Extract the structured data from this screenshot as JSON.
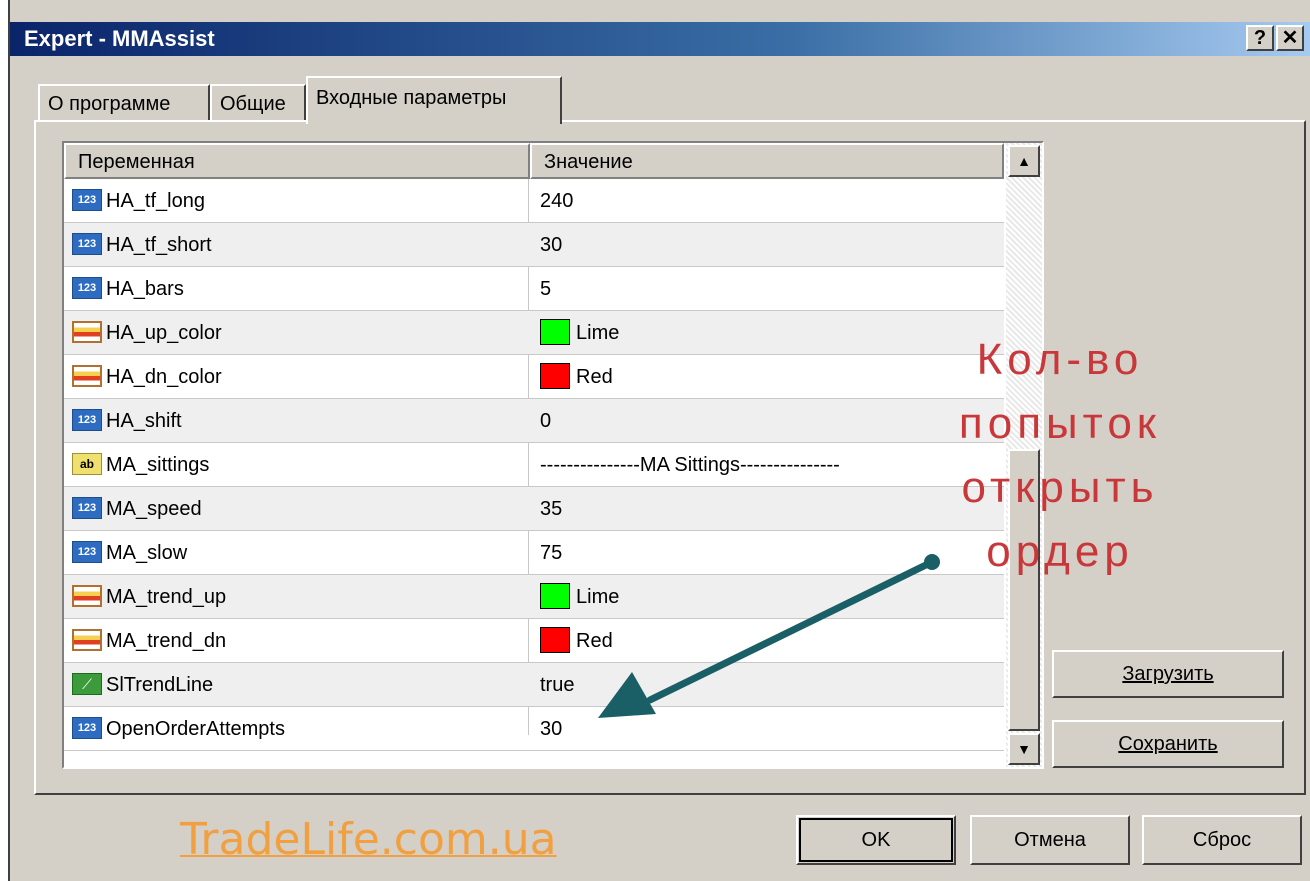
{
  "window": {
    "title": "Expert - MMAssist",
    "help_label": "?",
    "close_label": "✕"
  },
  "tabs": [
    {
      "label": "О программе"
    },
    {
      "label": "Общие"
    },
    {
      "label": "Входные параметры"
    }
  ],
  "grid": {
    "headers": [
      "Переменная",
      "Значение"
    ],
    "rows": [
      {
        "icon": "number-icon",
        "name": "HA_tf_long",
        "value": "240"
      },
      {
        "icon": "number-icon",
        "name": "HA_tf_short",
        "value": "30"
      },
      {
        "icon": "number-icon",
        "name": "HA_bars",
        "value": "5"
      },
      {
        "icon": "color-icon",
        "name": "HA_up_color",
        "value": "Lime",
        "color": "#00ff00"
      },
      {
        "icon": "color-icon",
        "name": "HA_dn_color",
        "value": "Red",
        "color": "#ff0000"
      },
      {
        "icon": "number-icon",
        "name": "HA_shift",
        "value": "0"
      },
      {
        "icon": "string-icon",
        "name": "MA_sittings",
        "value": "---------------MA Sittings---------------"
      },
      {
        "icon": "number-icon",
        "name": "MA_speed",
        "value": "35"
      },
      {
        "icon": "number-icon",
        "name": "MA_slow",
        "value": "75"
      },
      {
        "icon": "color-icon",
        "name": "MA_trend_up",
        "value": "Lime",
        "color": "#00ff00"
      },
      {
        "icon": "color-icon",
        "name": "MA_trend_dn",
        "value": "Red",
        "color": "#ff0000"
      },
      {
        "icon": "bool-icon",
        "name": "SlTrendLine",
        "value": "true"
      },
      {
        "icon": "number-icon",
        "name": "OpenOrderAttempts",
        "value": "30"
      }
    ],
    "scroll_up": "▲",
    "scroll_down": "▼"
  },
  "side_buttons": {
    "load": "Загрузить",
    "save": "Сохранить"
  },
  "footer_buttons": {
    "ok": "OK",
    "cancel": "Отмена",
    "reset": "Сброс"
  },
  "annotation": {
    "text": "Кол-во попыток открыть ордер",
    "color": "#c8383a",
    "arrow_color": "#1a5e66"
  },
  "watermark": "TradeLife.com.ua"
}
